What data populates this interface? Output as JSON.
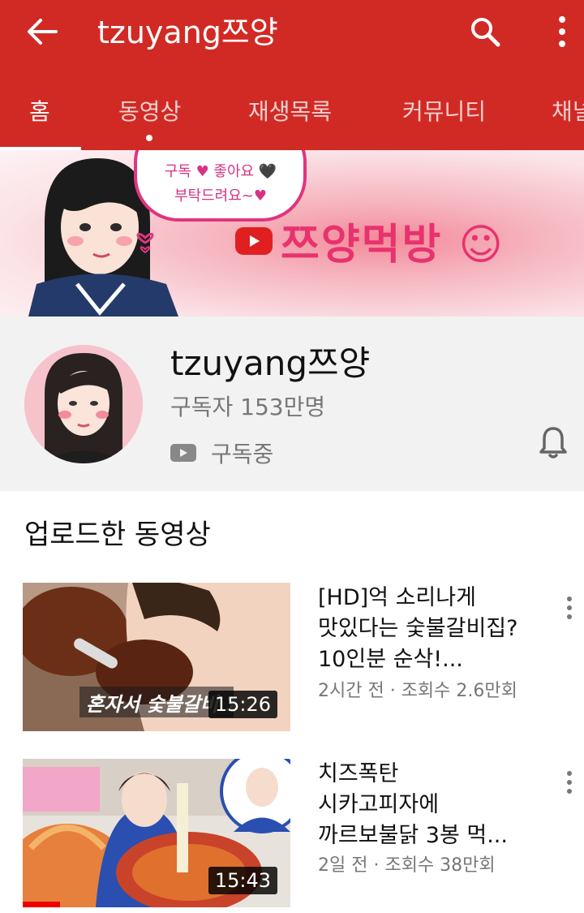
{
  "appbar": {
    "title": "tzuyang쯔양",
    "back_icon": "back-arrow-icon",
    "search_icon": "search-icon",
    "more_icon": "more-vert-icon",
    "background_color": "#d12a24"
  },
  "tabs": [
    {
      "label": "홈",
      "active": true
    },
    {
      "label": "동영상",
      "active": false
    },
    {
      "label": "재생목록",
      "active": false
    },
    {
      "label": "커뮤니티",
      "active": false
    },
    {
      "label": "채널",
      "active": false
    }
  ],
  "banner": {
    "bubble_line1": "구독 ♥ 좋아요 🖤",
    "bubble_line2": "부탁드려요~♥",
    "brand": "쯔양먹방 ☺"
  },
  "channel": {
    "name": "tzuyang쯔양",
    "subscribers": "구독자 153만명",
    "subscribed_label": "구독중",
    "bell_icon": "bell-icon"
  },
  "section": {
    "title": "업로드한 동영상"
  },
  "videos": [
    {
      "title_line1": "[HD]억 소리나게",
      "title_line2": "맛있다는 숯불갈비집?",
      "title_line3": "10인분 순삭!...",
      "meta": "2시간 전 · 조회수 2.6만회",
      "duration": "15:26",
      "thumb_caption": "혼자서 숯불갈비 1",
      "watched_fraction": 0
    },
    {
      "title_line1": "치즈폭탄",
      "title_line2": "시카고피자에",
      "title_line3": "까르보불닭 3봉 먹...",
      "meta": "2일 전 · 조회수 38만회",
      "duration": "15:43",
      "watched_fraction": 0.14
    }
  ]
}
